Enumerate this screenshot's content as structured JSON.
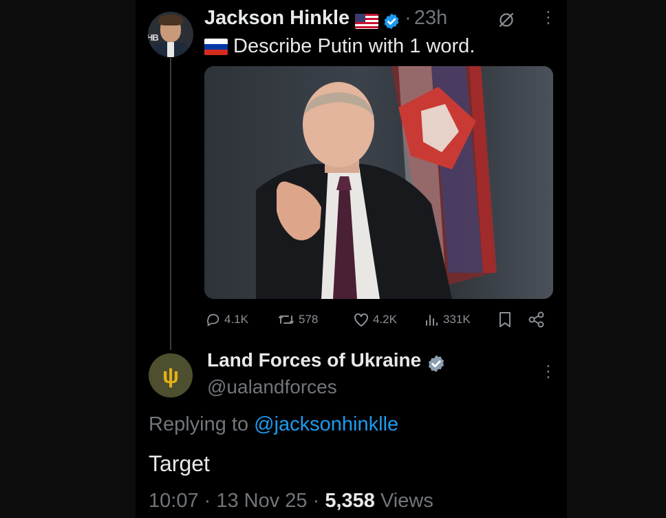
{
  "original_tweet": {
    "author_name": "Jackson Hinkle",
    "time_ago": "23h",
    "avatar_initials": "HB",
    "text": "Describe Putin with 1 word.",
    "icons": [
      "us-flag-icon",
      "verified-badge-icon",
      "grok-icon",
      "more-icon",
      "russia-flag-icon"
    ],
    "stats": {
      "replies": "4.1K",
      "reposts": "578",
      "likes": "4.2K",
      "views": "331K"
    }
  },
  "reply_tweet": {
    "author_name": "Land Forces of Ukraine",
    "handle": "@ualandforces",
    "replying_prefix": "Replying to",
    "replying_handle": "@jacksonhinklle",
    "text": "Target",
    "time": "10:07",
    "date": "13 Nov 25",
    "views_count": "5,358",
    "views_label": "Views"
  },
  "colors": {
    "background": "#000000",
    "text": "#e7e9ea",
    "muted": "#71767b",
    "link": "#1d9bf0",
    "verified": "#1d9bf0",
    "trident": "#e3b018"
  }
}
